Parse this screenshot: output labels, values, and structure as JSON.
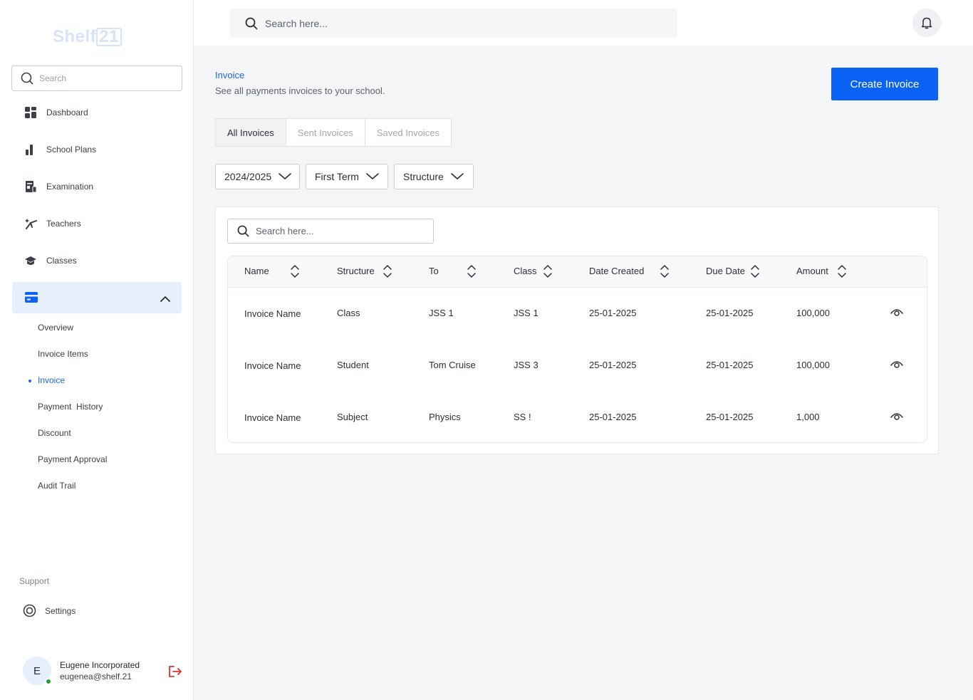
{
  "brand": {
    "logo_text": "Shelf",
    "logo_box": "21"
  },
  "sidebar": {
    "search_placeholder": "Search",
    "items": [
      {
        "label": "Dashboard",
        "icon": "grid-icon"
      },
      {
        "label": "School Plans",
        "icon": "bar-chart-icon"
      },
      {
        "label": "Examination",
        "icon": "exam-icon"
      },
      {
        "label": "Teachers",
        "icon": "teachers-icon"
      },
      {
        "label": "Classes",
        "icon": "graduation-cap-icon"
      }
    ],
    "payments_icon": "credit-card-icon",
    "sub_items": [
      {
        "label": "Overview"
      },
      {
        "label": "Invoice Items"
      },
      {
        "label": "Invoice",
        "active": true
      },
      {
        "label": "Payment  History"
      },
      {
        "label": "Discount"
      },
      {
        "label": "Payment Approval"
      },
      {
        "label": "Audit Trail"
      }
    ],
    "support_label": "Support",
    "settings_label": "Settings",
    "user": {
      "initial": "E",
      "name": "Eugene Incorporated",
      "email": "eugenea@shelf.21"
    }
  },
  "topbar": {
    "search_placeholder": "Search here..."
  },
  "main": {
    "title": "Invoice",
    "subtitle": "See all payments invoices to your school.",
    "create_button": "Create Invoice",
    "tabs": [
      {
        "label": "All Invoices",
        "active": true
      },
      {
        "label": "Sent Invoices"
      },
      {
        "label": "Saved Invoices"
      }
    ],
    "filters": {
      "session": "2024/2025",
      "term": "First Term",
      "structure": "Structure"
    },
    "table_search_placeholder": "Search here...",
    "columns": [
      "Name",
      "Structure",
      "To",
      "Class",
      "Date Created",
      "Due Date",
      "Amount"
    ],
    "rows": [
      [
        "Invoice Name",
        "Class",
        "JSS 1",
        "JSS 1",
        "25-01-2025",
        "25-01-2025",
        "100,000"
      ],
      [
        "Invoice Name",
        "Student",
        "Tom Cruise",
        "JSS 3",
        "25-01-2025",
        "25-01-2025",
        "100,000"
      ],
      [
        "Invoice Name",
        "Subject",
        "Physics",
        "SS !",
        "25-01-2025",
        "25-01-2025",
        "1,000"
      ]
    ]
  },
  "colors": {
    "accent": "#0b63f6",
    "active_nav_bg": "#e7effc",
    "logout": "#e0332f",
    "online": "#1e9e3e"
  }
}
